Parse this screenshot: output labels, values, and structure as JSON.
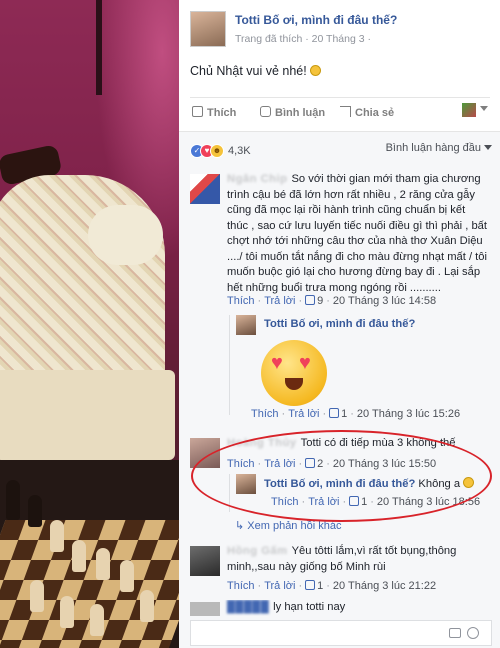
{
  "post": {
    "page_name": "Totti Bố ơi, mình đi đâu thế?",
    "meta": "Trang đã thích · 20 Tháng 3 ·",
    "text": "Chủ Nhật vui vẻ nhé!"
  },
  "actions": {
    "like": "Thích",
    "comment": "Bình luận",
    "share": "Chia sẻ"
  },
  "reactions": {
    "count": "4,3K"
  },
  "sort_label": "Bình luận hàng đầu",
  "comments": [
    {
      "author": "Ngân Chip",
      "text": "So với thời gian mới tham gia chương trình cậu bé đã lớn hơn rất nhiều , 2 răng cửa gẫy cũng đã mọc lại rồi hành trình cũng chuẩn bị kết thúc , sao cứ lưu luyến tiếc nuối điều gì thì phải , bất chợt nhớ tới những câu thơ của nhà thơ Xuân Diệu ..../ tôi muốn tắt nắng đi cho màu đừng nhạt mất / tôi muốn buộc gió lại cho hương đừng bay đi . Lại sắp hết những buổi trưa mong ngóng rồi ..........",
      "like": "Thích",
      "reply": "Trả lời",
      "likes": "9",
      "time": "20 Tháng 3 lúc 14:58"
    },
    {
      "author": "Hoàng Thủy",
      "text": "Totti có đi tiếp mùa 3 không thế",
      "like": "Thích",
      "reply": "Trả lời",
      "likes": "2",
      "time": "20 Tháng 3 lúc 15:50"
    },
    {
      "author": "Hồng Gấm",
      "text": "Yêu tôtti lắm,vì rất tốt bụng,thông minh,,sau này giống bố Minh rùi",
      "like": "Thích",
      "reply": "Trả lời",
      "likes": "1",
      "time": "20 Tháng 3 lúc 21:22"
    }
  ],
  "replies": [
    {
      "author": "Totti Bố ơi, mình đi đâu thế?",
      "text": "",
      "like": "Thích",
      "reply": "Trả lời",
      "likes": "1",
      "time": "20 Tháng 3 lúc 15:26"
    },
    {
      "author": "Totti Bố ơi, mình đi đâu thế?",
      "text": "Không a",
      "like": "Thích",
      "reply": "Trả lời",
      "likes": "1",
      "time": "20 Tháng 3 lúc 18:56"
    }
  ],
  "more_replies": "Xem phản hồi khác",
  "partial_text": "ly hạn totti nay",
  "colors": {
    "link": "#365899",
    "annotation": "#d8232a"
  }
}
